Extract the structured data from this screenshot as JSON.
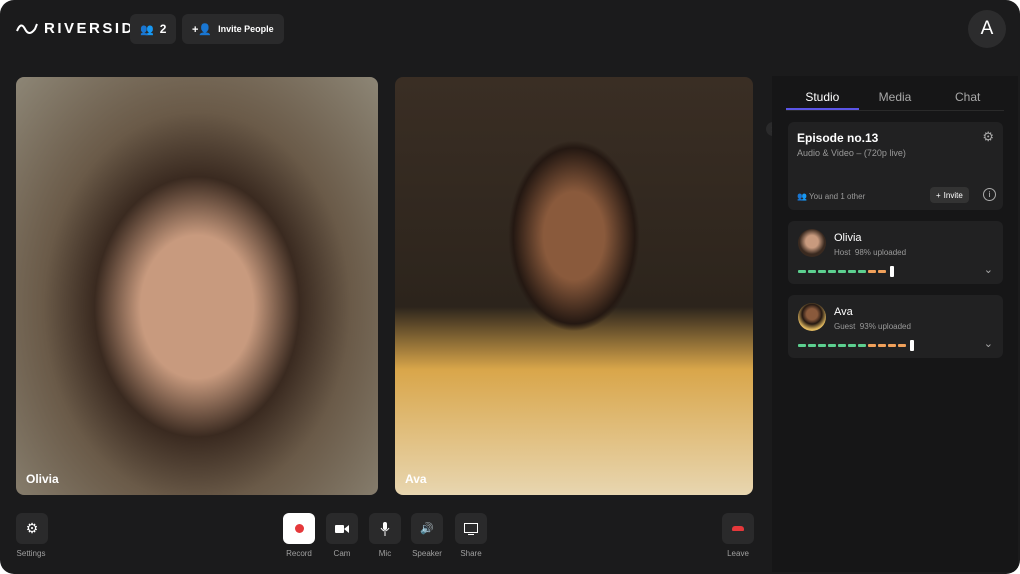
{
  "header": {
    "brand": "RIVERSIDE",
    "participants_count": "2",
    "invite_label": "Invite People",
    "avatar_initial": "A"
  },
  "videos": [
    {
      "name": "Olivia"
    },
    {
      "name": "Ava"
    }
  ],
  "toolbar": {
    "settings": "Settings",
    "record": "Record",
    "cam": "Cam",
    "mic": "Mic",
    "speaker": "Speaker",
    "share": "Share",
    "leave": "Leave",
    "record_color": "#e5383b",
    "leave_color": "#e5383b"
  },
  "panel": {
    "tabs": [
      "Studio",
      "Media",
      "Chat"
    ],
    "episode": {
      "title": "Episode no.13",
      "subtitle": "Audio & Video – (720p live)",
      "people": "You and 1 other",
      "invite": "Invite"
    },
    "participants": [
      {
        "name": "Olivia",
        "role": "Host",
        "status": "98% uploaded",
        "green_segments": 7,
        "orange_segments": 2
      },
      {
        "name": "Ava",
        "role": "Guest",
        "status": "93% uploaded",
        "green_segments": 7,
        "orange_segments": 4
      }
    ]
  }
}
